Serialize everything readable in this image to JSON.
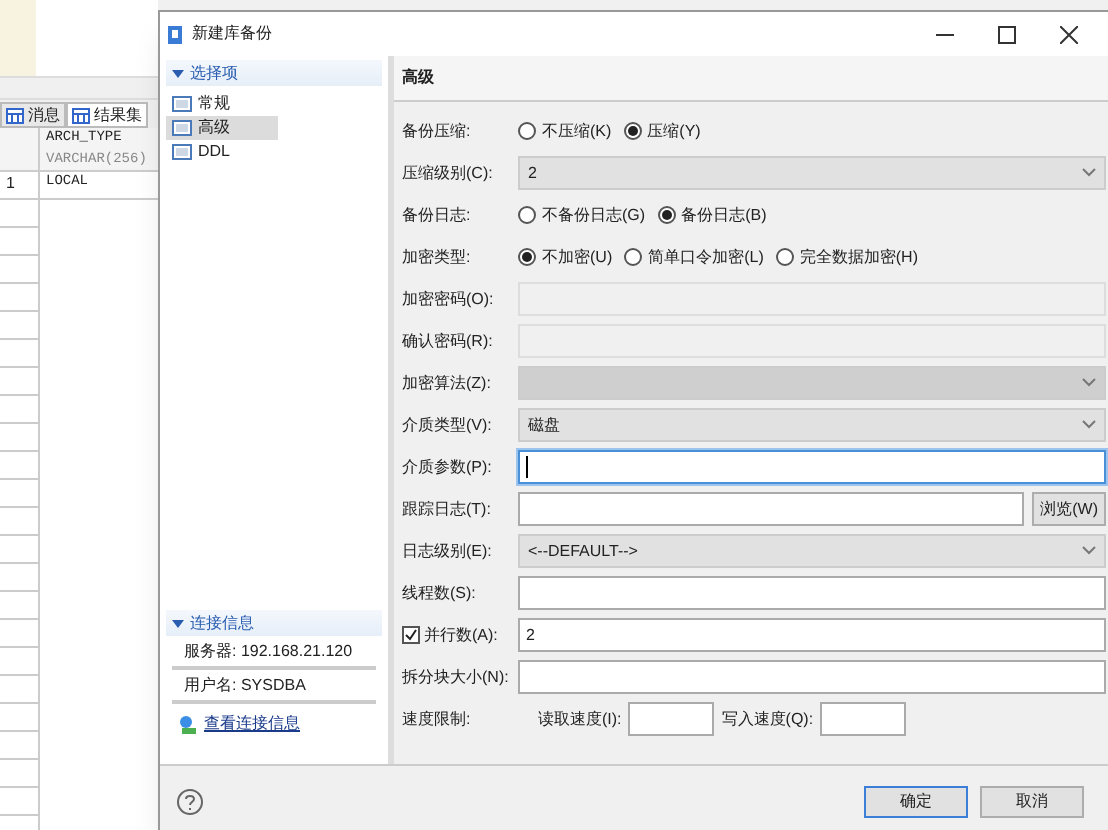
{
  "background": {
    "tabs": [
      {
        "label": "消息",
        "selected": false
      },
      {
        "label": "结果集",
        "selected": true
      }
    ],
    "grid": {
      "columns": [
        {
          "name": "ARCH_TYPE",
          "type": "VARCHAR(256)"
        }
      ],
      "rows": [
        {
          "number": "1",
          "cells": [
            "LOCAL"
          ]
        }
      ]
    }
  },
  "dialog": {
    "title": "新建库备份",
    "nav": {
      "title": "选择项",
      "items": [
        {
          "label": "常规",
          "selected": false
        },
        {
          "label": "高级",
          "selected": true
        },
        {
          "label": "DDL",
          "selected": false
        }
      ]
    },
    "connection": {
      "title": "连接信息",
      "lines": [
        "服务器: 192.168.21.120",
        "用户名: SYSDBA"
      ],
      "link": "查看连接信息"
    },
    "panel_title": "高级",
    "fields": [
      {
        "kind": "radio",
        "label": "备份压缩:",
        "options": [
          {
            "label": "不压缩(K)",
            "selected": false
          },
          {
            "label": "压缩(Y)",
            "selected": true
          }
        ]
      },
      {
        "kind": "select",
        "label": "压缩级别(C):",
        "value": "2",
        "disabled": false
      },
      {
        "kind": "radio",
        "label": "备份日志:",
        "options": [
          {
            "label": "不备份日志(G)",
            "selected": false
          },
          {
            "label": "备份日志(B)",
            "selected": true
          }
        ]
      },
      {
        "kind": "radio",
        "label": "加密类型:",
        "options": [
          {
            "label": "不加密(U)",
            "selected": true
          },
          {
            "label": "简单口令加密(L)",
            "selected": false
          },
          {
            "label": "完全数据加密(H)",
            "selected": false
          }
        ]
      },
      {
        "kind": "input",
        "label": "加密密码(O):",
        "disabled": true,
        "focused": false
      },
      {
        "kind": "input",
        "label": "确认密码(R):",
        "disabled": true,
        "focused": false
      },
      {
        "kind": "select",
        "label": "加密算法(Z):",
        "disabled": true
      },
      {
        "kind": "select",
        "label": "介质类型(V):",
        "value": "磁盘",
        "disabled": false
      },
      {
        "kind": "input",
        "label": "介质参数(P):",
        "disabled": false,
        "focused": true
      },
      {
        "kind": "browse",
        "label": "跟踪日志(T):",
        "button": "浏览(W)"
      },
      {
        "kind": "select",
        "label": "日志级别(E):",
        "value": "<--DEFAULT-->",
        "disabled": false
      },
      {
        "kind": "input",
        "label": "线程数(S):",
        "disabled": false,
        "focused": false
      },
      {
        "kind": "check",
        "label": "并行数(A):",
        "checked": true,
        "value": "2"
      },
      {
        "kind": "input",
        "label": "拆分块大小(N):",
        "disabled": false,
        "focused": false
      },
      {
        "kind": "speed",
        "label": "速度限制:",
        "read_label": "读取速度(I):",
        "write_label": "写入速度(Q):"
      }
    ],
    "buttons": [
      "确定",
      "取消"
    ]
  }
}
